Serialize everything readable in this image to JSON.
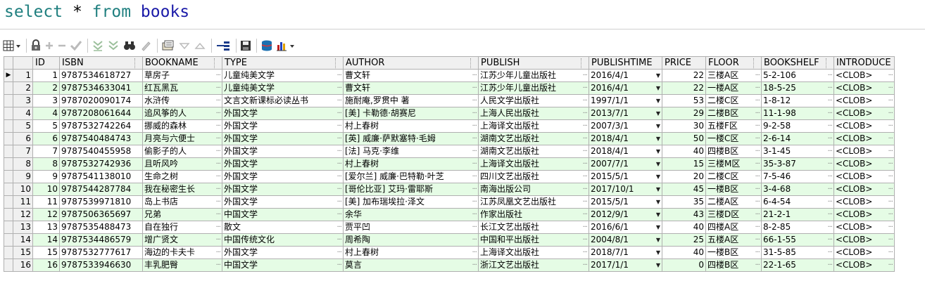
{
  "sql": {
    "kw1": "select",
    "op": "*",
    "kw2": "from",
    "table": "books"
  },
  "toolbar": {
    "icons": [
      "grid-menu-icon",
      "lock-icon",
      "add-record-icon",
      "delete-record-icon",
      "post-edit-icon",
      "filter-down-icon",
      "filter-all-icon",
      "find-binoculars-icon",
      "clear-icon",
      "query-by-example-icon",
      "next-triangle-icon",
      "prev-triangle-icon",
      "export-icon",
      "save-icon",
      "database-icon",
      "chart-icon"
    ]
  },
  "columns": [
    "ID",
    "ISBN",
    "BOOKNAME",
    "TYPE",
    "AUTHOR",
    "PUBLISH",
    "PUBLISHTIME",
    "PRICE",
    "FLOOR",
    "BOOKSHELF",
    "INTRODUCE"
  ],
  "rows": [
    {
      "rn": "1",
      "id": "1",
      "isbn": "9787534618727",
      "name": "草房子",
      "type": "儿童纯美文学",
      "author": "曹文轩",
      "publish": "江苏少年儿童出版社",
      "time": "2016/4/1",
      "price": "22",
      "floor": "三楼A区",
      "shelf": "5-2-106",
      "intro": "<CLOB>"
    },
    {
      "rn": "2",
      "id": "2",
      "isbn": "9787534633041",
      "name": "红瓦黑瓦",
      "type": "儿童纯美文学",
      "author": "曹文轩",
      "publish": "江苏少年儿童出版社",
      "time": "2016/4/1",
      "price": "22",
      "floor": "一楼A区",
      "shelf": "18-5-25",
      "intro": "<CLOB>"
    },
    {
      "rn": "3",
      "id": "3",
      "isbn": "9787020090174",
      "name": "水浒传",
      "type": "文言文新课标必读丛书",
      "author": "施耐庵,罗贯中 著",
      "publish": "人民文学出版社",
      "time": "1997/1/1",
      "price": "53",
      "floor": "二楼C区",
      "shelf": "1-8-12",
      "intro": "<CLOB>"
    },
    {
      "rn": "4",
      "id": "4",
      "isbn": "9787208061644",
      "name": "追风筝的人",
      "type": "外国文学",
      "author": "[美] 卡勒德·胡赛尼",
      "publish": "上海人民出版社",
      "time": "2013/7/1",
      "price": "29",
      "floor": "二楼B区",
      "shelf": "11-1-98",
      "intro": "<CLOB>"
    },
    {
      "rn": "5",
      "id": "5",
      "isbn": "9787532742264",
      "name": "挪威的森林",
      "type": "外国文学",
      "author": "村上春树",
      "publish": "上海译文出版社",
      "time": "2007/3/1",
      "price": "30",
      "floor": "五楼F区",
      "shelf": "9-2-58",
      "intro": "<CLOB>"
    },
    {
      "rn": "6",
      "id": "6",
      "isbn": "9787540484743",
      "name": "月亮与六便士",
      "type": "外国文学",
      "author": "[英] 威廉·萨默塞特·毛姆",
      "publish": "湖南文艺出版社",
      "time": "2018/4/1",
      "price": "50",
      "floor": "一楼C区",
      "shelf": "2-6-14",
      "intro": "<CLOB>"
    },
    {
      "rn": "7",
      "id": "7",
      "isbn": "9787540455958",
      "name": "偷影子的人",
      "type": "外国文学",
      "author": "[法] 马克·李维",
      "publish": "湖南文艺出版社",
      "time": "2018/4/1",
      "price": "40",
      "floor": "四楼B区",
      "shelf": "3-1-45",
      "intro": "<CLOB>"
    },
    {
      "rn": "8",
      "id": "8",
      "isbn": "9787532742936",
      "name": "且听风吟",
      "type": "外国文学",
      "author": "村上春树",
      "publish": "上海译文出版社",
      "time": "2007/7/1",
      "price": "15",
      "floor": "三楼M区",
      "shelf": "35-3-87",
      "intro": "<CLOB>"
    },
    {
      "rn": "9",
      "id": "9",
      "isbn": "9787541138010",
      "name": "生命之树",
      "type": "外国文学",
      "author": "[爱尔兰] 威廉·巴特勒·叶芝",
      "publish": "四川文艺出版社",
      "time": "2015/5/1",
      "price": "20",
      "floor": "二楼C区",
      "shelf": "7-5-46",
      "intro": "<CLOB>"
    },
    {
      "rn": "10",
      "id": "10",
      "isbn": "9787544287784",
      "name": "我在秘密生长",
      "type": "外国文学",
      "author": "[哥伦比亚] 艾玛·雷耶斯",
      "publish": "南海出版公司",
      "time": "2017/10/1",
      "price": "45",
      "floor": "一楼B区",
      "shelf": "3-4-68",
      "intro": "<CLOB>"
    },
    {
      "rn": "11",
      "id": "11",
      "isbn": "9787539971810",
      "name": "岛上书店",
      "type": "外国文学",
      "author": "[美] 加布瑞埃拉·泽文",
      "publish": "江苏凤凰文艺出版社",
      "time": "2015/5/1",
      "price": "35",
      "floor": "二楼A区",
      "shelf": "6-4-54",
      "intro": "<CLOB>"
    },
    {
      "rn": "12",
      "id": "12",
      "isbn": "9787506365697",
      "name": "兄弟",
      "type": "中国文学",
      "author": "余华",
      "publish": "作家出版社",
      "time": "2012/9/1",
      "price": "43",
      "floor": "三楼D区",
      "shelf": "21-2-1",
      "intro": "<CLOB>"
    },
    {
      "rn": "13",
      "id": "13",
      "isbn": "9787535488473",
      "name": "自在独行",
      "type": "散文",
      "author": "贾平凹",
      "publish": "长江文艺出版社",
      "time": "2016/6/1",
      "price": "40",
      "floor": "四楼A区",
      "shelf": "8-2-85",
      "intro": "<CLOB>"
    },
    {
      "rn": "14",
      "id": "14",
      "isbn": "9787534486579",
      "name": "增广贤文",
      "type": "中国传统文化",
      "author": "周希陶",
      "publish": "中国和平出版社",
      "time": "2004/8/1",
      "price": "25",
      "floor": "五楼A区",
      "shelf": "66-1-55",
      "intro": "<CLOB>"
    },
    {
      "rn": "15",
      "id": "15",
      "isbn": "9787532777617",
      "name": "海边的卡夫卡",
      "type": "外国文学",
      "author": "村上春树",
      "publish": "上海译文出版社",
      "time": "2018/7/1",
      "price": "40",
      "floor": "一楼B区",
      "shelf": "31-5-85",
      "intro": "<CLOB>"
    },
    {
      "rn": "16",
      "id": "16",
      "isbn": "9787533946630",
      "name": "丰乳肥臀",
      "type": "中国文学",
      "author": "莫言",
      "publish": "浙江文艺出版社",
      "time": "2017/1/1",
      "price": "0",
      "floor": "四楼B区",
      "shelf": "22-1-65",
      "intro": "<CLOB>"
    }
  ],
  "colors": {
    "even_row": "#e5fce5",
    "odd_row": "#ffffff",
    "keyword": "#1f7f7f",
    "identifier": "#1a1aa8"
  }
}
